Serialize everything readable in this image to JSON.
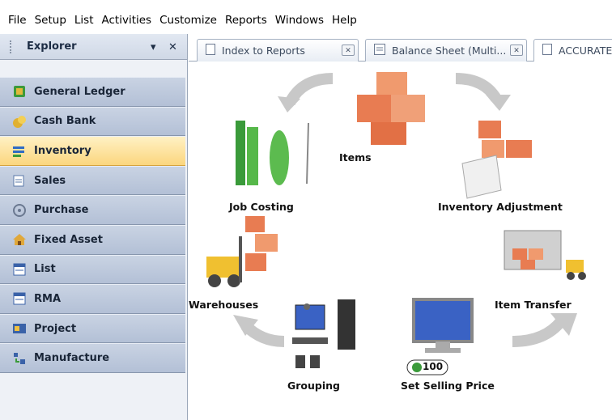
{
  "menubar": {
    "items": [
      "File",
      "Setup",
      "List",
      "Activities",
      "Customize",
      "Reports",
      "Windows",
      "Help"
    ]
  },
  "explorer": {
    "title": "Explorer",
    "pin_glyph": "▾",
    "close_glyph": "✕",
    "items": [
      {
        "label": "General Ledger",
        "icon": "ledger-icon"
      },
      {
        "label": "Cash Bank",
        "icon": "cash-bank-icon"
      },
      {
        "label": "Inventory",
        "icon": "inventory-icon",
        "active": true
      },
      {
        "label": "Sales",
        "icon": "sales-icon"
      },
      {
        "label": "Purchase",
        "icon": "purchase-icon"
      },
      {
        "label": "Fixed Asset",
        "icon": "fixed-asset-icon"
      },
      {
        "label": "List",
        "icon": "list-icon"
      },
      {
        "label": "RMA",
        "icon": "rma-icon"
      },
      {
        "label": "Project",
        "icon": "project-icon"
      },
      {
        "label": "Manufacture",
        "icon": "manufacture-icon"
      }
    ]
  },
  "tabs": [
    {
      "label": "Index to Reports",
      "close": "✕"
    },
    {
      "label": "Balance Sheet (Multi...",
      "close": "✕"
    },
    {
      "label": "ACCURATE"
    }
  ],
  "diagram": {
    "items": "Items",
    "job_costing": "Job Costing",
    "inventory_adjustment": "Inventory Adjustment",
    "warehouses": "Warehouses",
    "item_transfer": "Item Transfer",
    "grouping": "Grouping",
    "set_selling_price": "Set Selling Price",
    "price_tag": "100"
  },
  "colors": {
    "nav_bg": "#b9c5d9",
    "nav_active": "#fbd67e",
    "box": "#e87c52",
    "arrow": "#c8c8c8"
  }
}
